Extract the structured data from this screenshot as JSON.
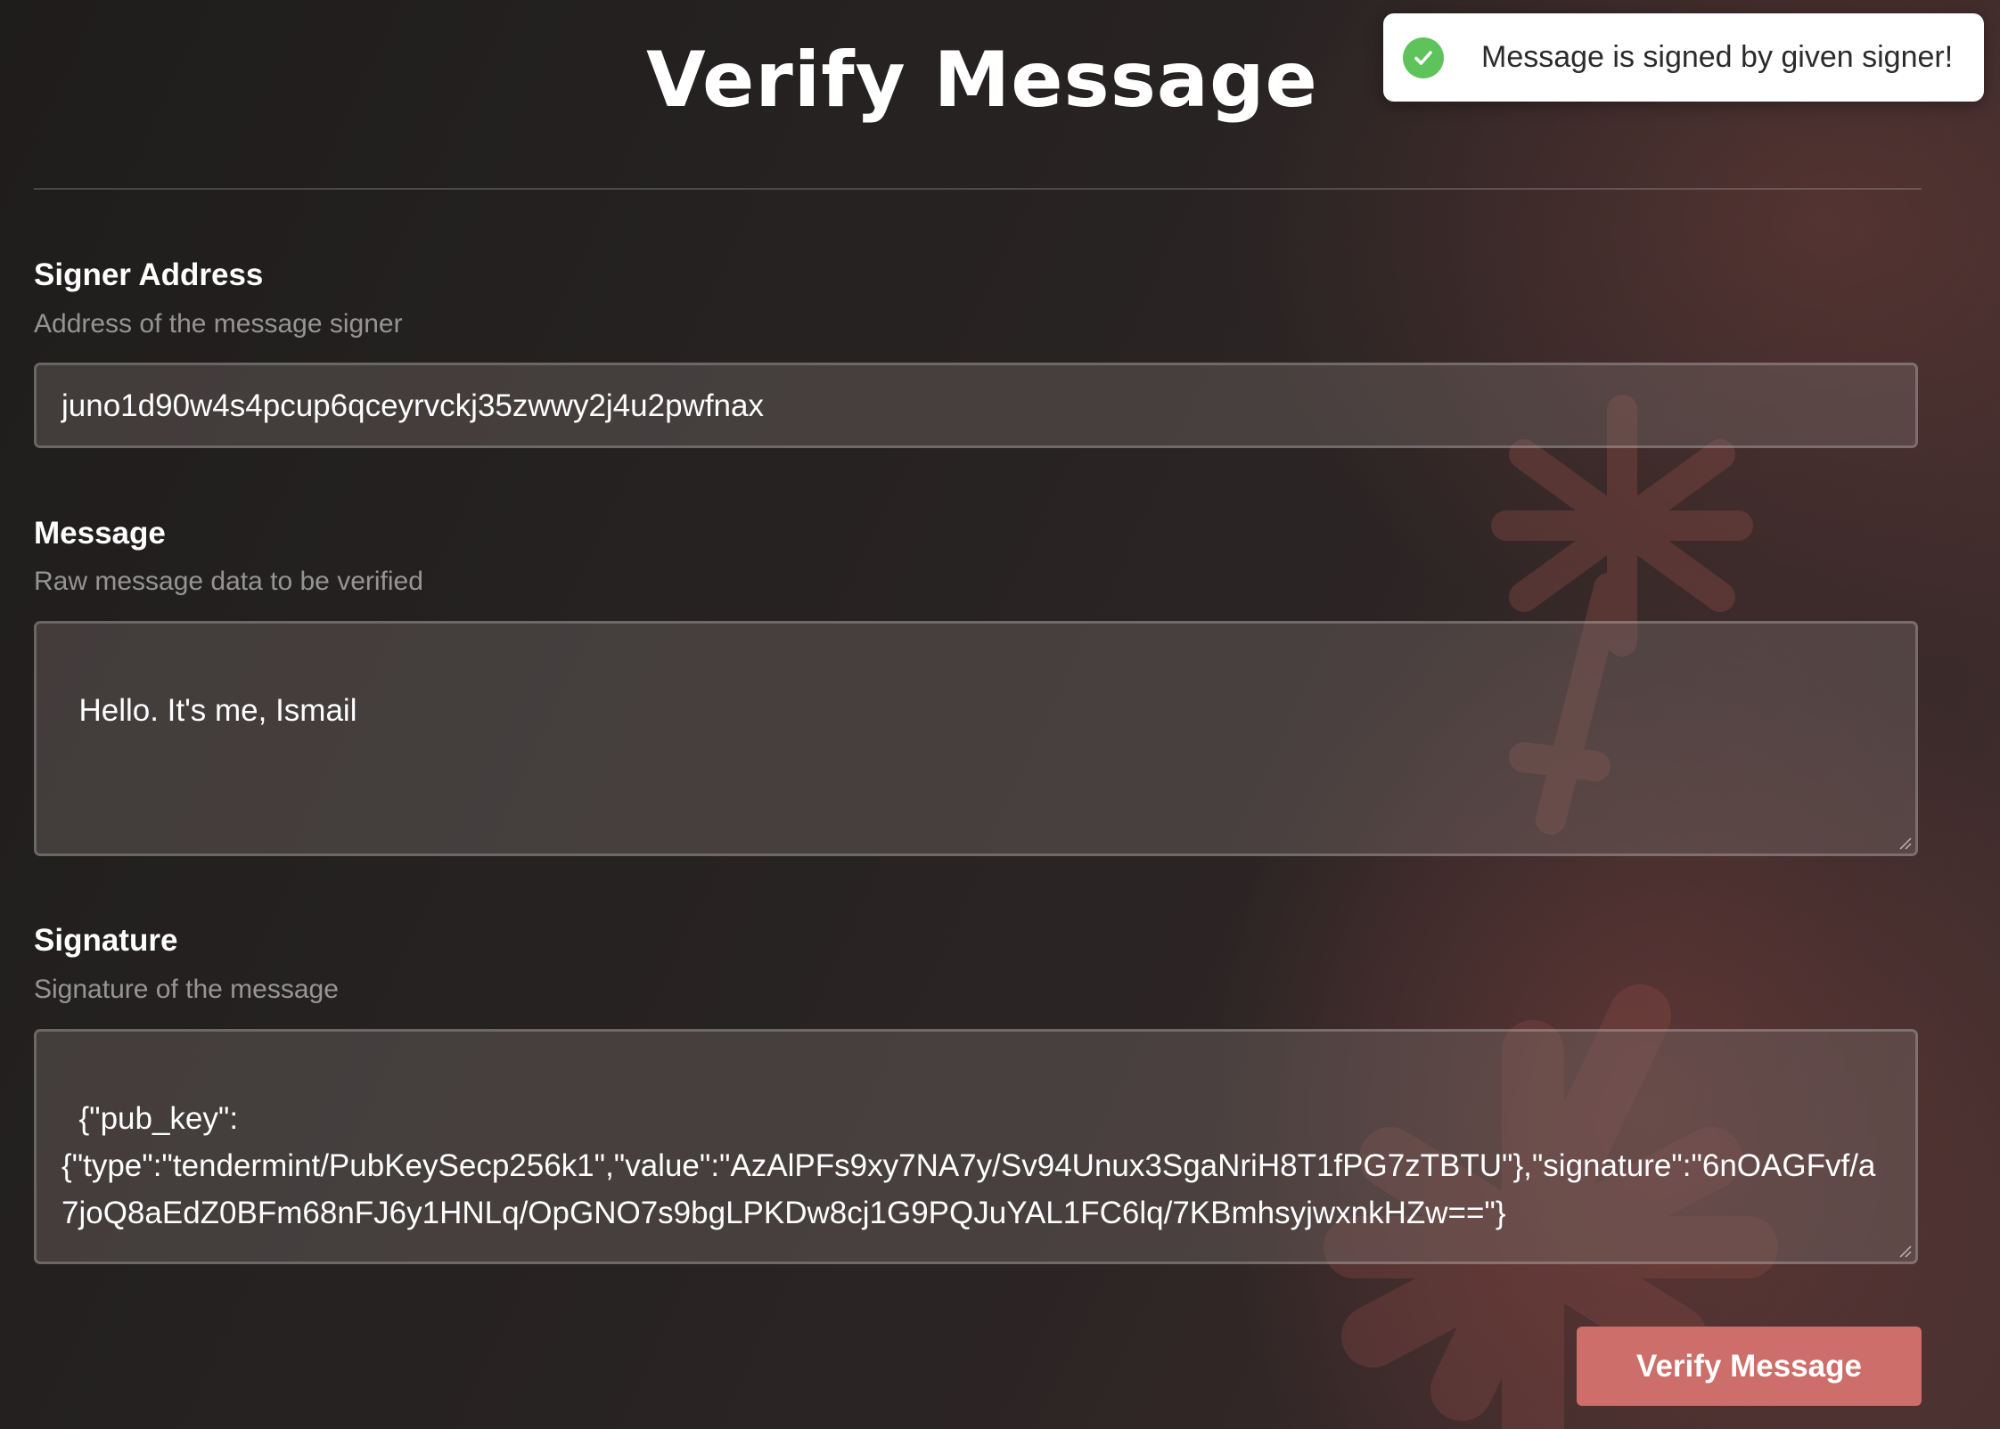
{
  "page": {
    "title": "Verify Message"
  },
  "fields": {
    "signer": {
      "label": "Signer Address",
      "description": "Address of the message signer",
      "value": "juno1d90w4s4pcup6qceyrvckj35zwwy2j4u2pwfnax"
    },
    "message": {
      "label": "Message",
      "description": "Raw message data to be verified",
      "value": "Hello. It's me, Ismail"
    },
    "signature": {
      "label": "Signature",
      "description": "Signature of the message",
      "value": "{\"pub_key\":\n{\"type\":\"tendermint/PubKeySecp256k1\",\"value\":\"AzAlPFs9xy7NA7y/Sv94Unux3SgaNriH8T1fPG7zTBTU\"},\"signature\":\"6nOAGFvf/a7joQ8aEdZ0BFm68nFJ6y1HNLq/OpGNO7s9bgLPKDw8cj1G9PQJuYAL1FC6lq/7KBmhsyjwxnkHZw==\"}"
    }
  },
  "actions": {
    "verify_label": "Verify Message"
  },
  "toast": {
    "message": "Message is signed by given signer!",
    "icon": "check-circle-icon",
    "status_color": "#5ec35a"
  },
  "theme": {
    "accent": "#cd6e6a",
    "background": "#252121"
  }
}
